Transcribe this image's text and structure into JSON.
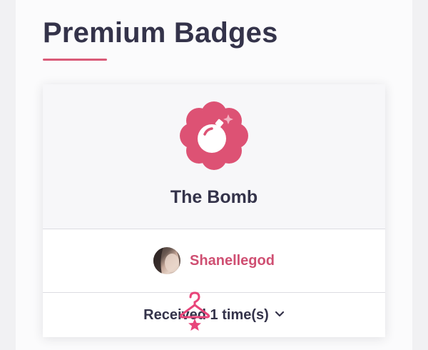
{
  "page": {
    "title": "Premium Badges"
  },
  "badge": {
    "name": "The Bomb",
    "icon": "bomb-icon",
    "accent_color": "#dd5274"
  },
  "user": {
    "name": "Shanellegod",
    "avatar": "avatar"
  },
  "received": {
    "label": "Received 1 time(s)",
    "toggle_icon": "chevron-down-icon"
  },
  "overlay": {
    "icon": "hanger-icon"
  }
}
